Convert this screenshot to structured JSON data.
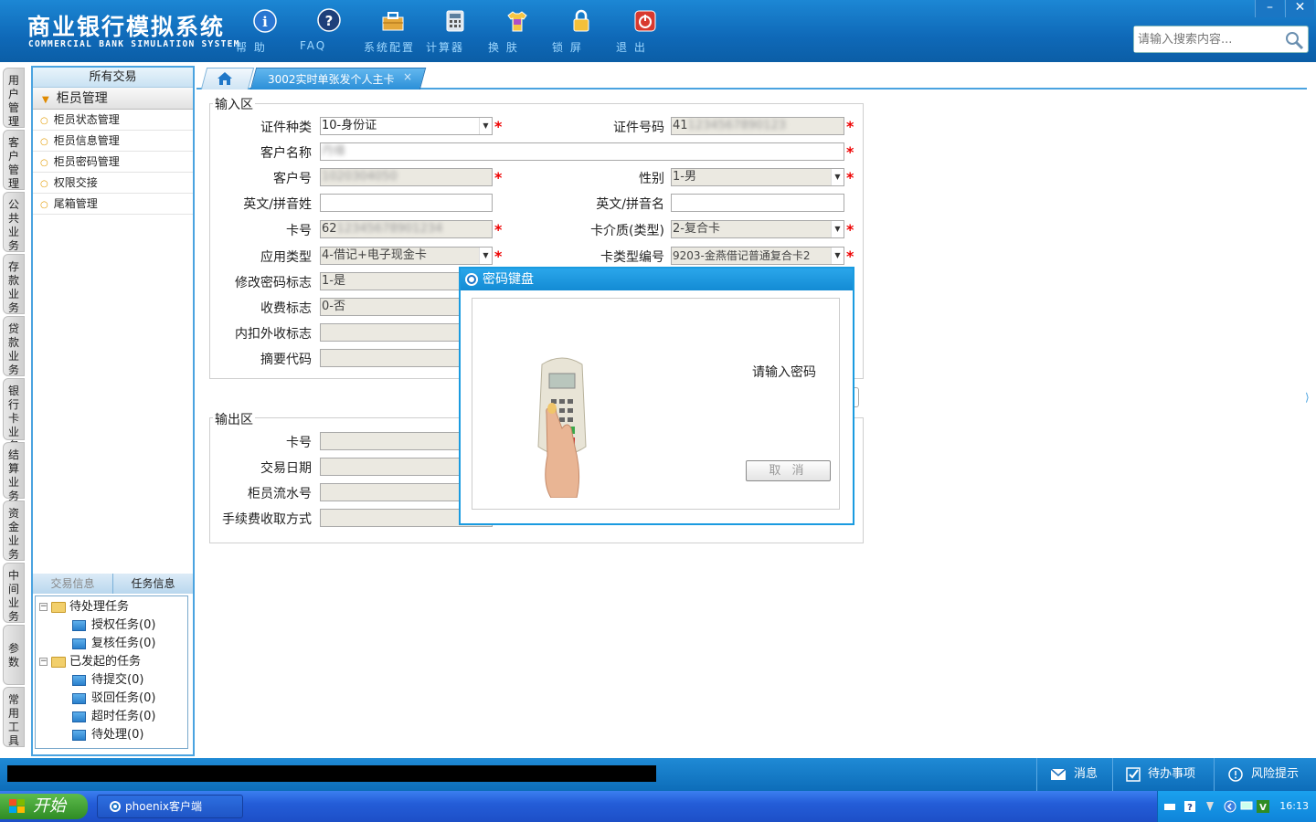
{
  "header": {
    "title_cn": "商业银行模拟系统",
    "title_en": "COMMERCIAL BANK SIMULATION SYSTEM",
    "toolbar": [
      {
        "label": "帮 助",
        "icon": "info-icon"
      },
      {
        "label": "FAQ",
        "icon": "question-icon"
      },
      {
        "label": "系统配置",
        "icon": "toolbox-icon"
      },
      {
        "label": "计算器",
        "icon": "calculator-icon"
      },
      {
        "label": "换 肤",
        "icon": "shirt-icon"
      },
      {
        "label": "锁 屏",
        "icon": "lock-icon"
      },
      {
        "label": "退 出",
        "icon": "power-icon"
      }
    ],
    "search_placeholder": "请输入搜索内容...",
    "win_min": "–",
    "win_close": "✕"
  },
  "vtabs": [
    "用户管理",
    "客户管理",
    "公共业务",
    "存款业务",
    "贷款业务",
    "银行卡业务",
    "结算业务",
    "资金业务",
    "中间业务",
    "参数",
    "常用工具"
  ],
  "left_panel": {
    "all_tx": "所有交易",
    "group": "柜员管理",
    "items": [
      "柜员状态管理",
      "柜员信息管理",
      "柜员密码管理",
      "权限交接",
      "尾箱管理"
    ],
    "tabs": [
      "交易信息",
      "任务信息"
    ],
    "tree": {
      "pending": "待处理任务",
      "pending_children": [
        "授权任务(0)",
        "复核任务(0)"
      ],
      "initiated": "已发起的任务",
      "initiated_children": [
        "待提交(0)",
        "驳回任务(0)",
        "超时任务(0)",
        "待处理(0)"
      ]
    }
  },
  "tabbar": {
    "active_tab": "3002实时单张发个人主卡",
    "close": "×"
  },
  "input_section": {
    "title": "输入区",
    "id_type_label": "证件种类",
    "id_type_value": "10-身份证",
    "id_no_label": "证件号码",
    "id_no_value": "41",
    "cust_name_label": "客户名称",
    "cust_no_label": "客户号",
    "gender_label": "性别",
    "gender_value": "1-男",
    "en_surname_label": "英文/拼音姓",
    "en_name_label": "英文/拼音名",
    "card_no_label": "卡号",
    "card_no_value": "62",
    "card_medium_label": "卡介质(类型)",
    "card_medium_value": "2-复合卡",
    "app_type_label": "应用类型",
    "app_type_value": "4-借记+电子现金卡",
    "card_type_no_label": "卡类型编号",
    "card_type_no_value": "9203-金燕借记普通复合卡2",
    "change_pwd_label": "修改密码标志",
    "change_pwd_value": "1-是",
    "fee_flag_label": "收费标志",
    "fee_flag_value": "0-否",
    "inner_outer_label": "内扣外收标志",
    "summary_code_label": "摘要代码",
    "required_mark": "*"
  },
  "output_section": {
    "title": "输出区",
    "card_no_label": "卡号",
    "tx_date_label": "交易日期",
    "teller_seq_label": "柜员流水号",
    "fee_method_label": "手续费收取方式"
  },
  "dialog": {
    "title": "密码键盘",
    "message": "请输入密码",
    "cancel": "取 消"
  },
  "statusbar": {
    "messages": "消息",
    "todo": "待办事项",
    "risk": "风险提示"
  },
  "taskbar": {
    "start": "开始",
    "task_item": "phoenix客户端",
    "clock": "16:13"
  },
  "colors": {
    "header_blue": "#0f69b8",
    "accent": "#4aa3e0",
    "required": "#e00000"
  }
}
